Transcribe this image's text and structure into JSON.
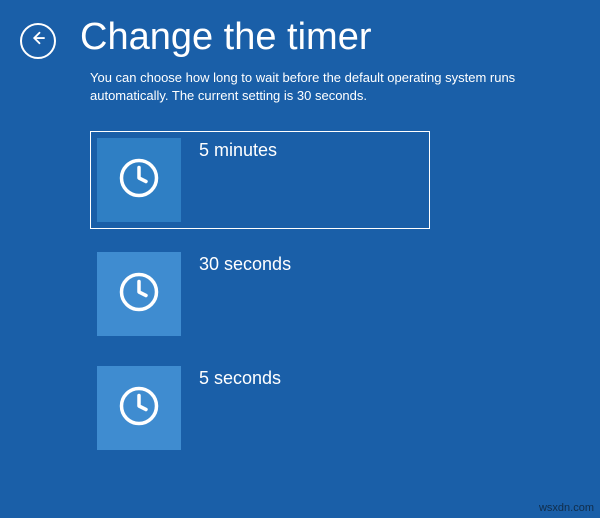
{
  "header": {
    "title": "Change the timer"
  },
  "description": "You can choose how long to wait before the default operating system runs automatically. The current setting is 30 seconds.",
  "options": [
    {
      "label": "5 minutes",
      "selected": true
    },
    {
      "label": "30 seconds",
      "selected": false
    },
    {
      "label": "5 seconds",
      "selected": false
    }
  ],
  "watermark": "wsxdn.com"
}
